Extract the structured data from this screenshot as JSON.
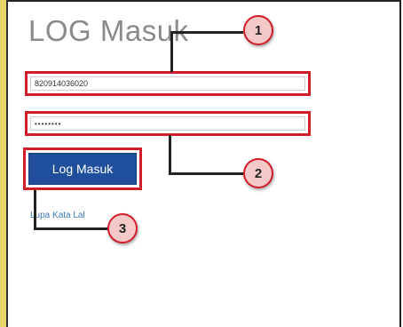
{
  "page": {
    "title": "LOG Masuk"
  },
  "form": {
    "username_value": "820914036020",
    "password_value": "••••••••",
    "login_label": "Log Masuk",
    "forgot_label": "Lupa Kata Lal"
  },
  "callouts": [
    "1",
    "2",
    "3"
  ],
  "colors": {
    "highlight": "#d11c2a",
    "button": "#1f4e9c",
    "badge_fill": "#f6c9c9",
    "link": "#3a78c0",
    "title": "#8a8a8a"
  }
}
